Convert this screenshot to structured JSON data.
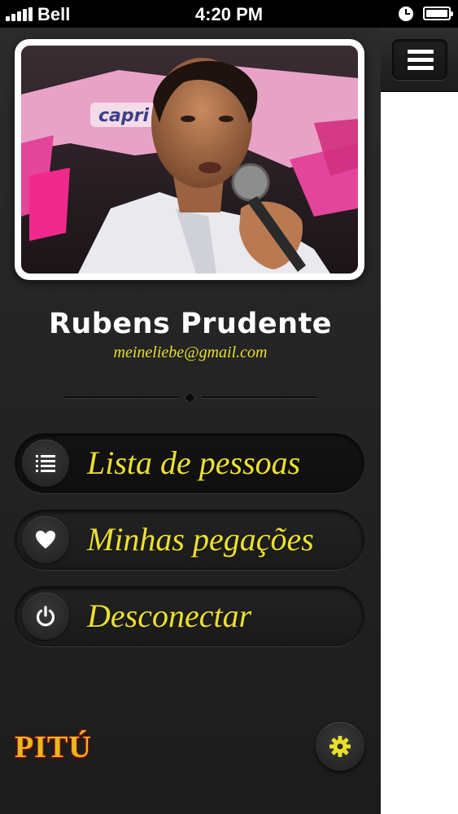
{
  "status_bar": {
    "carrier": "Bell",
    "time": "4:20 PM",
    "icons": [
      "signal-icon",
      "clock-icon",
      "battery-icon"
    ]
  },
  "profile": {
    "name": "Rubens Prudente",
    "email": "meineliebe@gmail.com",
    "photo_banner_text": "capri"
  },
  "menu": {
    "items": [
      {
        "label": "Lista de pessoas",
        "icon": "list-icon"
      },
      {
        "label": "Minhas pegações",
        "icon": "heart-icon"
      },
      {
        "label": "Desconectar",
        "icon": "power-icon"
      }
    ]
  },
  "footer": {
    "logo_text": "PITÚ",
    "settings_icon": "gear-icon"
  },
  "content": {
    "menu_button_icon": "hamburger-icon"
  },
  "colors": {
    "accent_yellow": "#ece031",
    "menu_background": "#252525",
    "content_background": "#ffffff"
  }
}
